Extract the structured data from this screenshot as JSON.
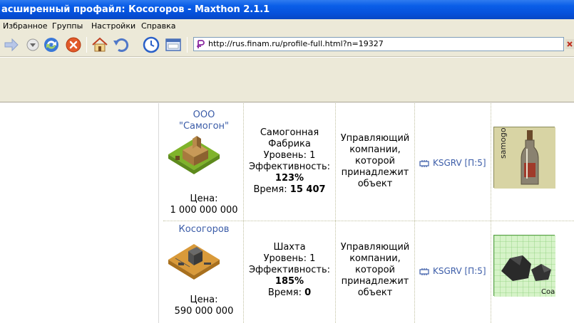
{
  "window": {
    "title": "асширенный профайл: Косогоров - Maxthon 2.1.1"
  },
  "menu": {
    "items": [
      "Избранное",
      "Группы",
      "Настройки",
      "Справка"
    ]
  },
  "toolbar": {
    "icons": [
      "forward-arrow-icon",
      "dropdown-icon",
      "refresh-icon",
      "stop-icon",
      "home-icon",
      "undo-icon",
      "history-clock-icon",
      "screen-icon"
    ]
  },
  "address": {
    "url": "http://rus.finam.ru/profile-full.html?n=19327"
  },
  "rows": [
    {
      "company_line1": "ООО",
      "company_line2": "\"Самогон\"",
      "price_label": "Цена:",
      "price_value": "1 000 000 000",
      "type": "Самогонная",
      "type2": "Фабрика",
      "level": "Уровень: 1",
      "efficiency_label": "Эффективность:",
      "efficiency": "123%",
      "time_label": "Время:",
      "time_value": "15 407",
      "status": [
        "Управляющий",
        "компании,",
        "которой",
        "принадлежит",
        "объект"
      ],
      "owner": "KSGRV [П:5]",
      "product_name": "samogon"
    },
    {
      "company_line1": "Косогоров",
      "price_label": "Цена:",
      "price_value": "590 000 000",
      "type": "Шахта",
      "level": "Уровень: 1",
      "efficiency_label": "Эффективность:",
      "efficiency": "185%",
      "time_label": "Время:",
      "time_value": "0",
      "status": [
        "Управляющий",
        "компании,",
        "которой",
        "принадлежит",
        "объект"
      ],
      "owner": "KSGRV [П:5]",
      "product_name": "Coal"
    }
  ],
  "colors": {
    "titlebar": "#0551db",
    "chrome": "#ece9d8",
    "link": "#3b5ca8"
  }
}
